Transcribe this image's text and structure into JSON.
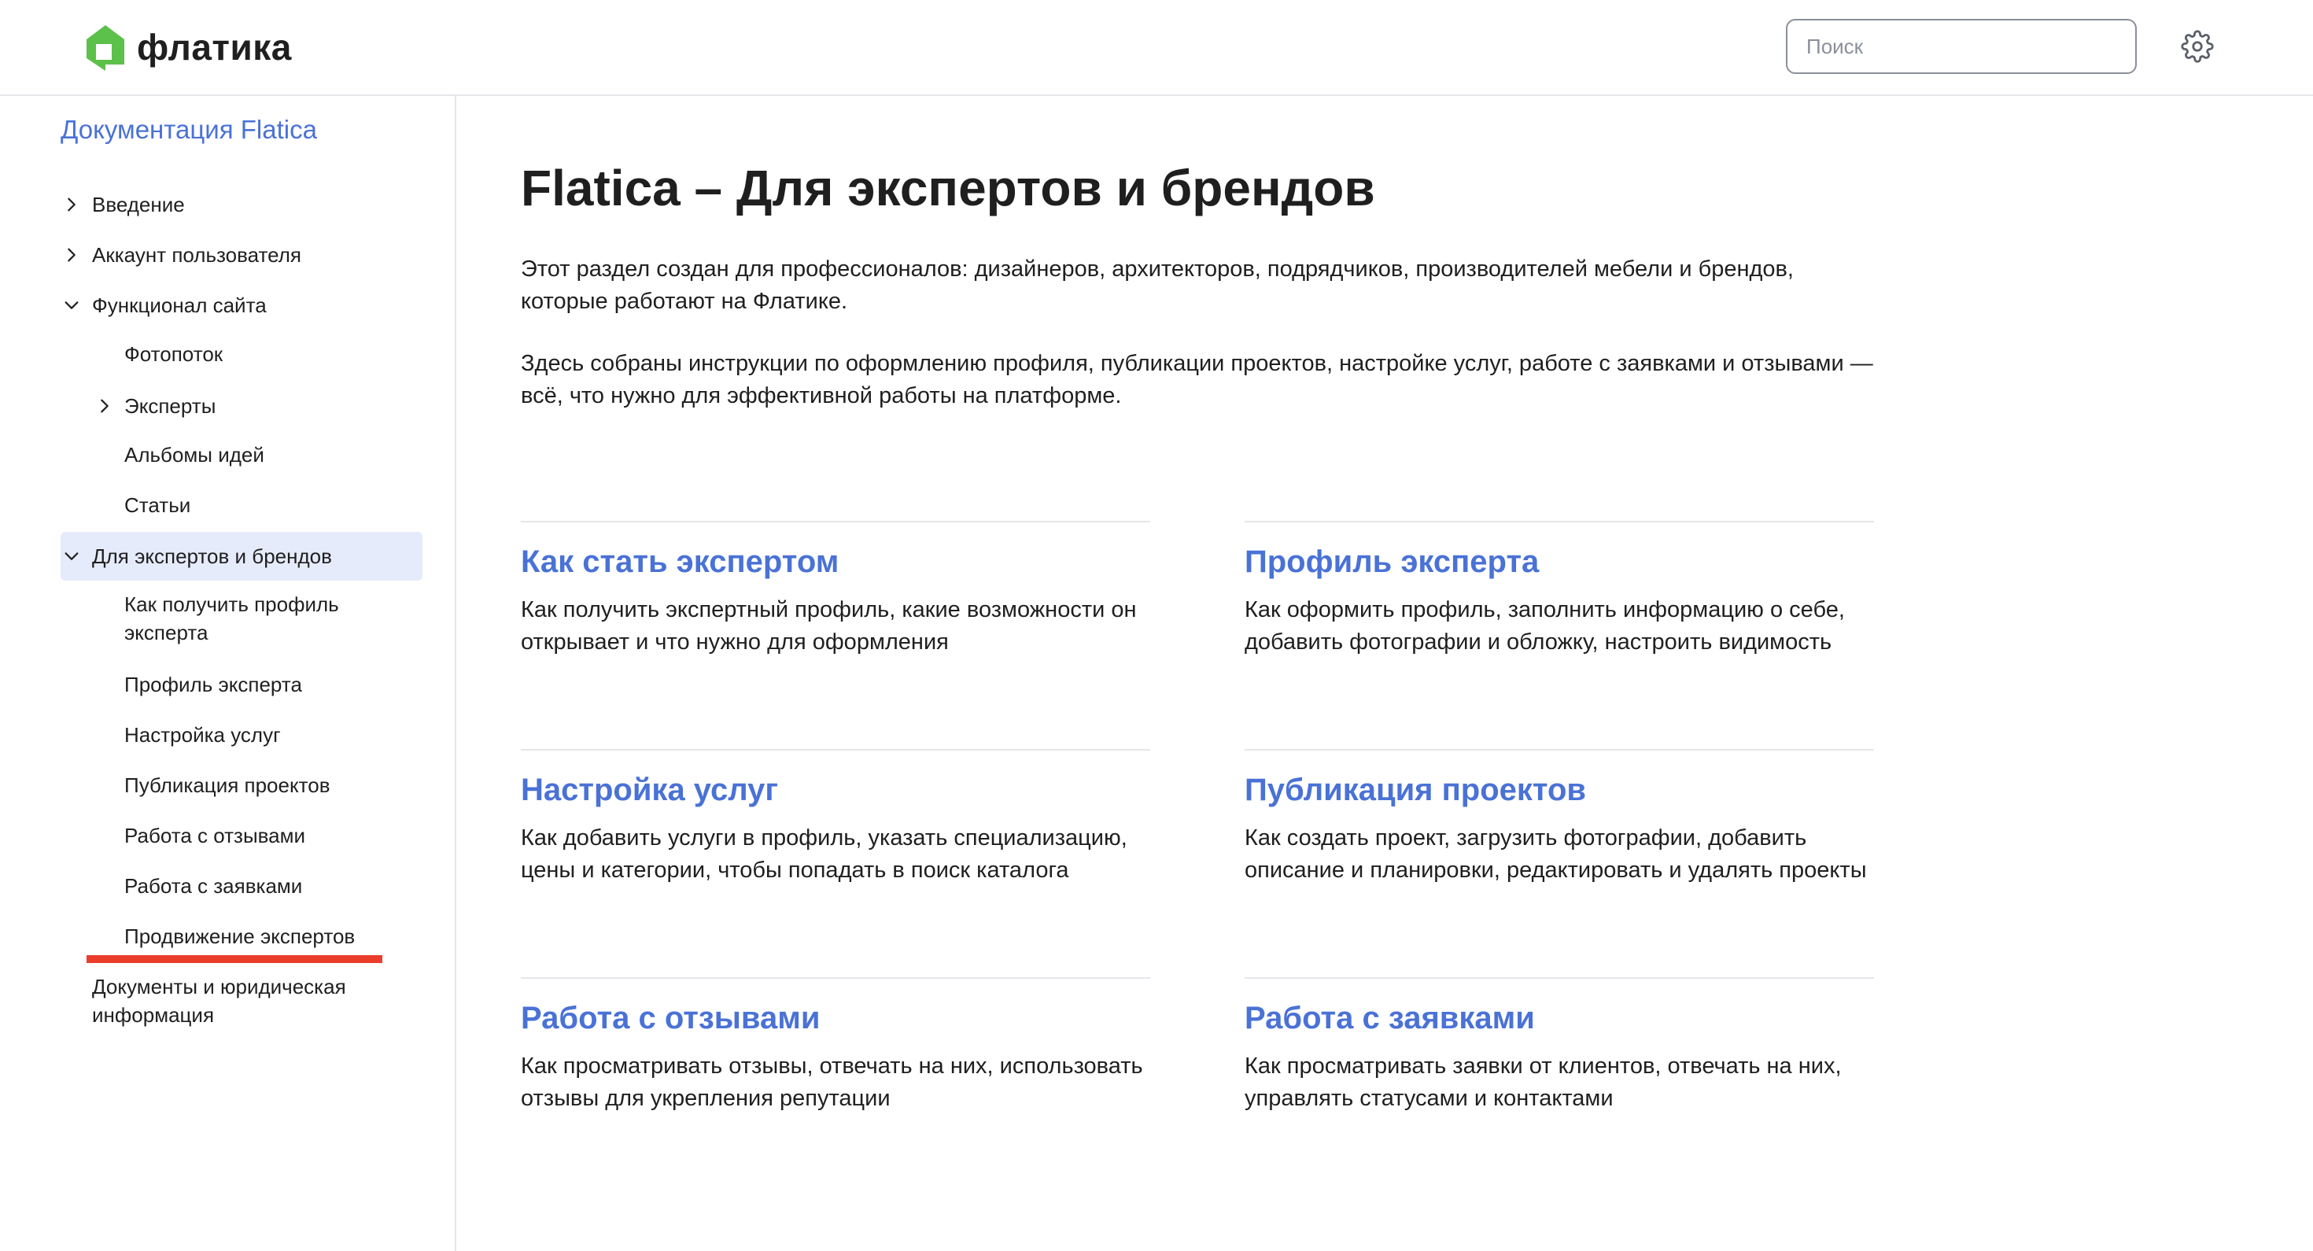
{
  "header": {
    "logo_text": "флатика",
    "search_placeholder": "Поиск"
  },
  "sidebar": {
    "title": "Документация Flatica",
    "items": [
      {
        "label": "Введение"
      },
      {
        "label": "Аккаунт пользователя"
      },
      {
        "label": "Функционал сайта"
      },
      {
        "label": "Фотопоток"
      },
      {
        "label": "Эксперты"
      },
      {
        "label": "Альбомы идей"
      },
      {
        "label": "Статьи"
      },
      {
        "label": "Для экспертов и брендов"
      },
      {
        "label": "Как получить профиль эксперта"
      },
      {
        "label": "Профиль эксперта"
      },
      {
        "label": "Настройка услуг"
      },
      {
        "label": "Публикация проектов"
      },
      {
        "label": "Работа с отзывами"
      },
      {
        "label": "Работа с заявками"
      },
      {
        "label": "Продвижение экспертов"
      },
      {
        "label": "Документы и юридическая информация"
      }
    ]
  },
  "main": {
    "title": "Flatica – Для экспертов и брендов",
    "intro_1": "Этот раздел создан для профессионалов: дизайнеров, архитекторов, подрядчиков, производителей мебели и брендов, которые работают на Флатике.",
    "intro_2": "Здесь собраны инструкции по оформлению профиля, публикации проектов, настройке услуг, работе с заявками и отзывами — всё, что нужно для эффективной работы на платформе.",
    "cards": [
      {
        "title": "Как стать экспертом",
        "desc": "Как получить экспертный профиль, какие возможности он открывает и что нужно для оформления"
      },
      {
        "title": "Профиль эксперта",
        "desc": "Как оформить профиль, заполнить информацию о себе, добавить фотографии и обложку, настроить видимость"
      },
      {
        "title": "Настройка услуг",
        "desc": "Как добавить услуги в профиль, указать специализацию, цены и категории, чтобы попадать в поиск каталога"
      },
      {
        "title": "Публикация проектов",
        "desc": "Как создать проект, загрузить фотографии, добавить описание и планировки, редактировать и удалять проекты"
      },
      {
        "title": "Работа с отзывами",
        "desc": "Как просматривать отзывы, отвечать на них, использовать отзывы для укрепления репутации"
      },
      {
        "title": "Работа с заявками",
        "desc": "Как просматривать заявки от клиентов, отвечать на них, управлять статусами и контактами"
      }
    ]
  },
  "colors": {
    "accent": "#4a72d6",
    "active_bg": "#e6ebfb",
    "highlight": "#ea3e2a",
    "logo_green": "#5cc14a"
  },
  "icons": {
    "logo": "house-logo-icon",
    "settings": "gear-icon",
    "expand": "chevron-right-icon",
    "collapse": "chevron-down-icon"
  }
}
